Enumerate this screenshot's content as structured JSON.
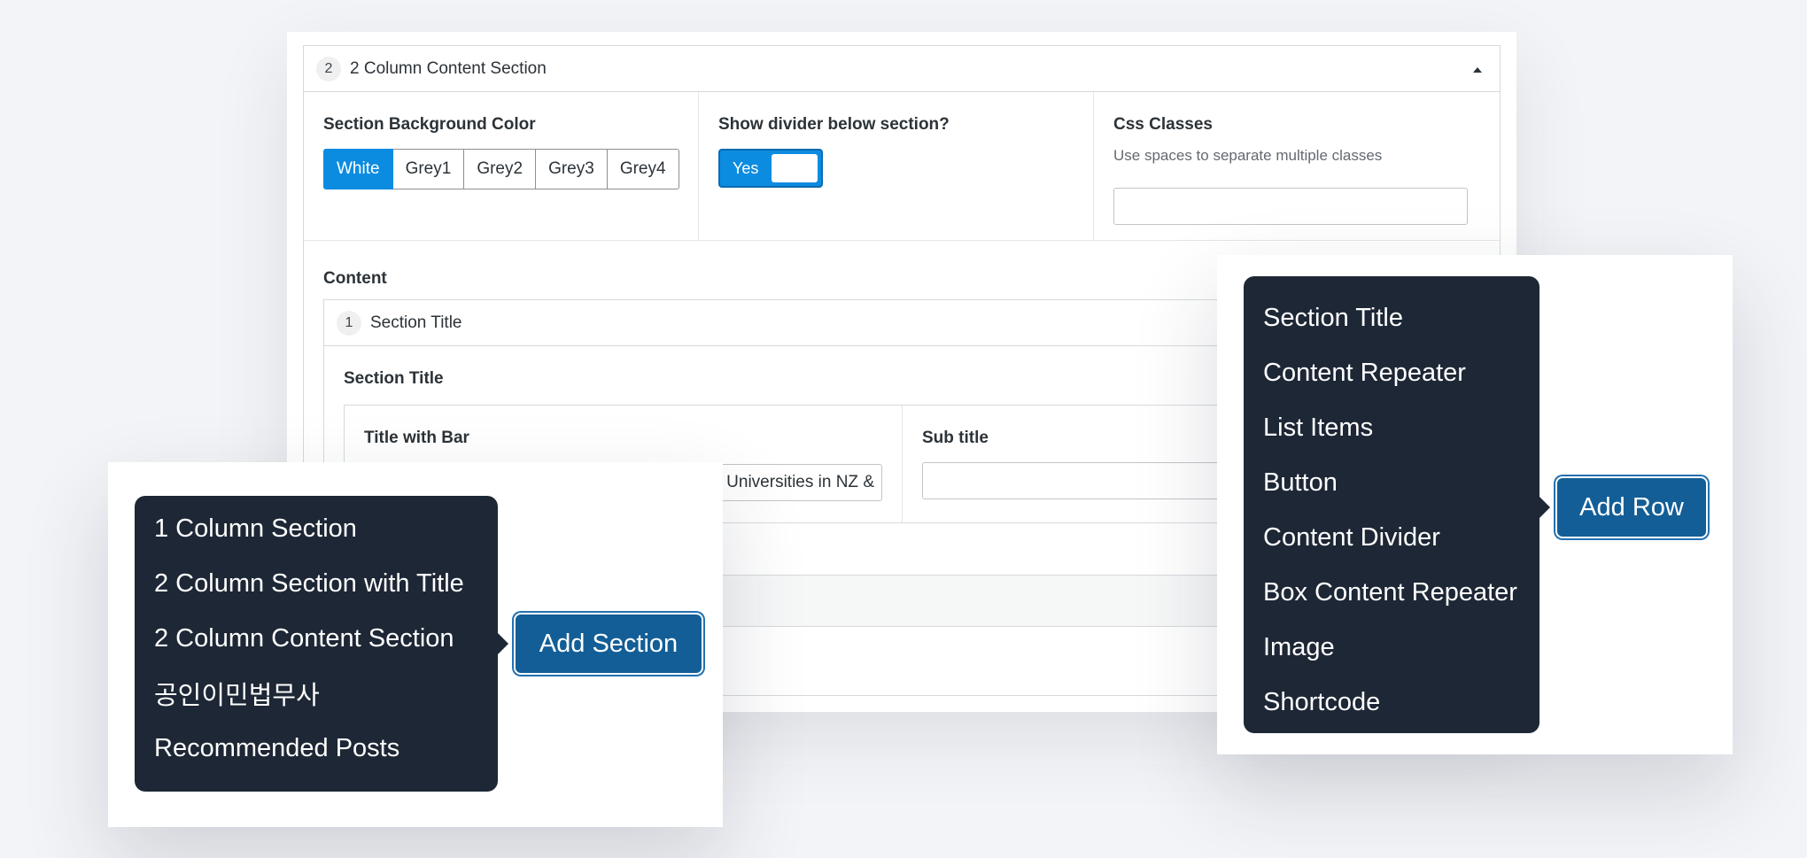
{
  "section": {
    "number": "2",
    "title": "2 Column Content Section",
    "bg_label": "Section Background Color",
    "bg_options": [
      "White",
      "Grey1",
      "Grey2",
      "Grey3",
      "Grey4"
    ],
    "bg_selected": "White",
    "divider_label": "Show divider below section?",
    "divider_value": "Yes",
    "css_label": "Css Classes",
    "css_hint": "Use spaces to separate multiple classes",
    "css_value": "",
    "content_label": "Content"
  },
  "row": {
    "number": "1",
    "title": "Section Title",
    "sub_label": "Section Title",
    "title_with_bar_label": "Title with Bar",
    "title_with_bar_value": "Universities in NZ &",
    "subtitle_label": "Sub title",
    "subtitle_value": ""
  },
  "add_section_menu": {
    "items": [
      "1 Column Section",
      "2 Column Section with Title",
      "2 Column Content Section",
      "공인이민법무사",
      "Recommended Posts"
    ],
    "button": "Add Section"
  },
  "add_row_menu": {
    "items": [
      "Section Title",
      "Content Repeater",
      "List Items",
      "Button",
      "Content Divider",
      "Box Content Repeater",
      "Image",
      "Shortcode"
    ],
    "button": "Add Row"
  },
  "colors": {
    "accent": "#0c8ce0",
    "button": "#135e96",
    "dropdown_bg": "#1d2735"
  }
}
